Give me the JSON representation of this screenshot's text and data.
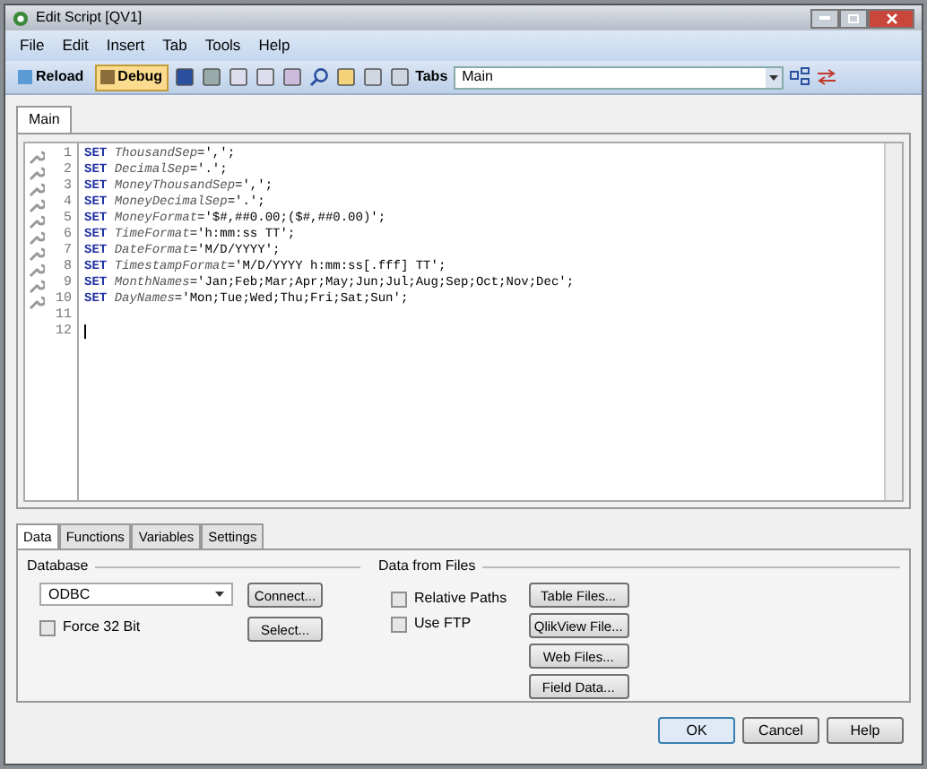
{
  "window": {
    "title": "Edit Script [QV1]"
  },
  "menu": [
    "File",
    "Edit",
    "Insert",
    "Tab",
    "Tools",
    "Help"
  ],
  "toolbar": {
    "buttons": [
      {
        "label": "Reload",
        "selected": false
      },
      {
        "label": "Debug",
        "selected": true
      }
    ],
    "tabs_label": "Tabs",
    "tabs_value": "Main"
  },
  "editor_tabs": [
    {
      "label": "Main",
      "selected": true
    }
  ],
  "code": [
    {
      "number": "1",
      "keyword": "SET",
      "name": "ThousandSep",
      "value": "=',';"
    },
    {
      "number": "2",
      "keyword": "SET",
      "name": "DecimalSep",
      "value": "='.';"
    },
    {
      "number": "3",
      "keyword": "SET",
      "name": "MoneyThousandSep",
      "value": "=',';"
    },
    {
      "number": "4",
      "keyword": "SET",
      "name": "MoneyDecimalSep",
      "value": "='.';"
    },
    {
      "number": "5",
      "keyword": "SET",
      "name": "MoneyFormat",
      "value": "='$#,##0.00;($#,##0.00)';"
    },
    {
      "number": "6",
      "keyword": "SET",
      "name": "TimeFormat",
      "value": "='h:mm:ss TT';"
    },
    {
      "number": "7",
      "keyword": "SET",
      "name": "DateFormat",
      "value": "='M/D/YYYY';"
    },
    {
      "number": "8",
      "keyword": "SET",
      "name": "TimestampFormat",
      "value": "='M/D/YYYY h:mm:ss[.fff] TT';"
    },
    {
      "number": "9",
      "keyword": "SET",
      "name": "MonthNames",
      "value": "='Jan;Feb;Mar;Apr;May;Jun;Jul;Aug;Sep;Oct;Nov;Dec';"
    },
    {
      "number": "10",
      "keyword": "SET",
      "name": "DayNames",
      "value": "='Mon;Tue;Wed;Thu;Fri;Sat;Sun';"
    },
    {
      "number": "11"
    },
    {
      "number": "12"
    }
  ],
  "bottom_tabs": [
    {
      "label": "Data",
      "selected": true
    },
    {
      "label": "Functions",
      "selected": false
    },
    {
      "label": "Variables",
      "selected": false
    },
    {
      "label": "Settings",
      "selected": false
    }
  ],
  "database": {
    "title": "Database",
    "value": "ODBC",
    "force_32bit": {
      "label": "Force 32 Bit",
      "checked": false
    },
    "buttons": [
      "Connect...",
      "Select..."
    ]
  },
  "data_from_files": {
    "title": "Data from Files",
    "checkboxes": [
      {
        "label": "Relative Paths",
        "checked": false
      },
      {
        "label": "Use FTP",
        "checked": false
      }
    ],
    "buttons": [
      "Table Files...",
      "QlikView File...",
      "Web Files...",
      "Field Data..."
    ]
  },
  "dialog_buttons": [
    {
      "label": "OK",
      "selected": true
    },
    {
      "label": "Cancel",
      "selected": false
    },
    {
      "label": "Help",
      "selected": false
    }
  ]
}
